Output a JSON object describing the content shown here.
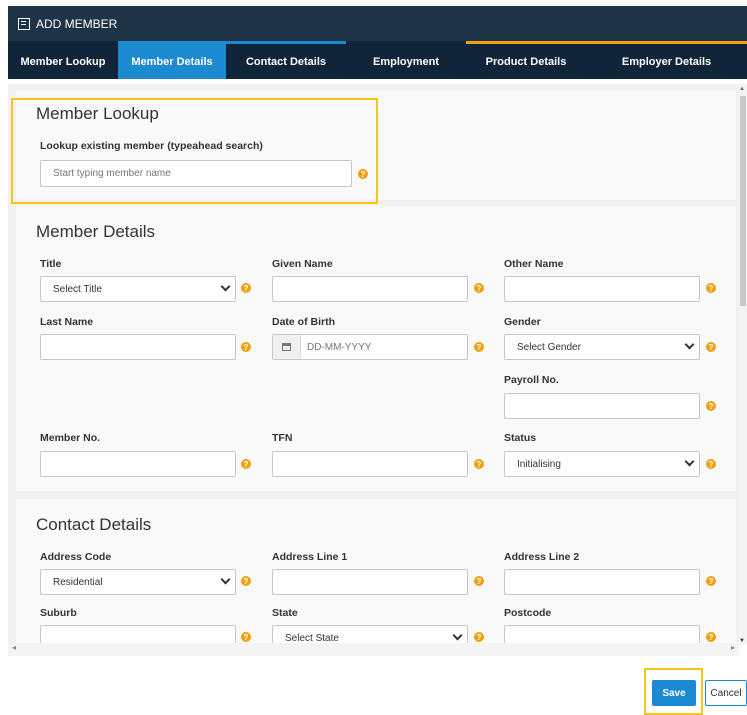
{
  "window": {
    "title": "ADD MEMBER"
  },
  "tabs": [
    {
      "label": "Member Lookup",
      "active": false
    },
    {
      "label": "Member Details",
      "active": true
    },
    {
      "label": "Contact Details",
      "active": false
    },
    {
      "label": "Employment",
      "active": false
    },
    {
      "label": "Product Details",
      "active": false
    },
    {
      "label": "Employer Details",
      "active": false
    }
  ],
  "tab_accent_colors": [
    "#10253a",
    "#1c8ad1",
    "#1c8ad1",
    "#10253a",
    "#f0a10f",
    "#f0a10f"
  ],
  "help_icon": "?",
  "lookup": {
    "heading": "Member Lookup",
    "label": "Lookup existing member (typeahead search)",
    "placeholder": "Start typing member name"
  },
  "member": {
    "heading": "Member Details",
    "title_label": "Title",
    "title_value": "Select Title",
    "given_label": "Given Name",
    "other_label": "Other Name",
    "last_label": "Last Name",
    "dob_label": "Date of Birth",
    "dob_placeholder": "DD-MM-YYYY",
    "gender_label": "Gender",
    "gender_value": "Select Gender",
    "payroll_label": "Payroll No.",
    "memberno_label": "Member No.",
    "tfn_label": "TFN",
    "status_label": "Status",
    "status_value": "Initialising"
  },
  "contact": {
    "heading": "Contact Details",
    "addrcode_label": "Address Code",
    "addrcode_value": "Residential",
    "addr1_label": "Address Line 1",
    "addr2_label": "Address Line 2",
    "suburb_label": "Suburb",
    "state_label": "State",
    "state_value": "Select State",
    "postcode_label": "Postcode"
  },
  "footer": {
    "save_label": "Save",
    "cancel_label": "Cancel"
  },
  "colors": {
    "header": "#1f3347",
    "tabbar": "#10253a",
    "accent": "#1c8ad1",
    "help": "#f0a10f",
    "highlight": "#f5c518"
  }
}
